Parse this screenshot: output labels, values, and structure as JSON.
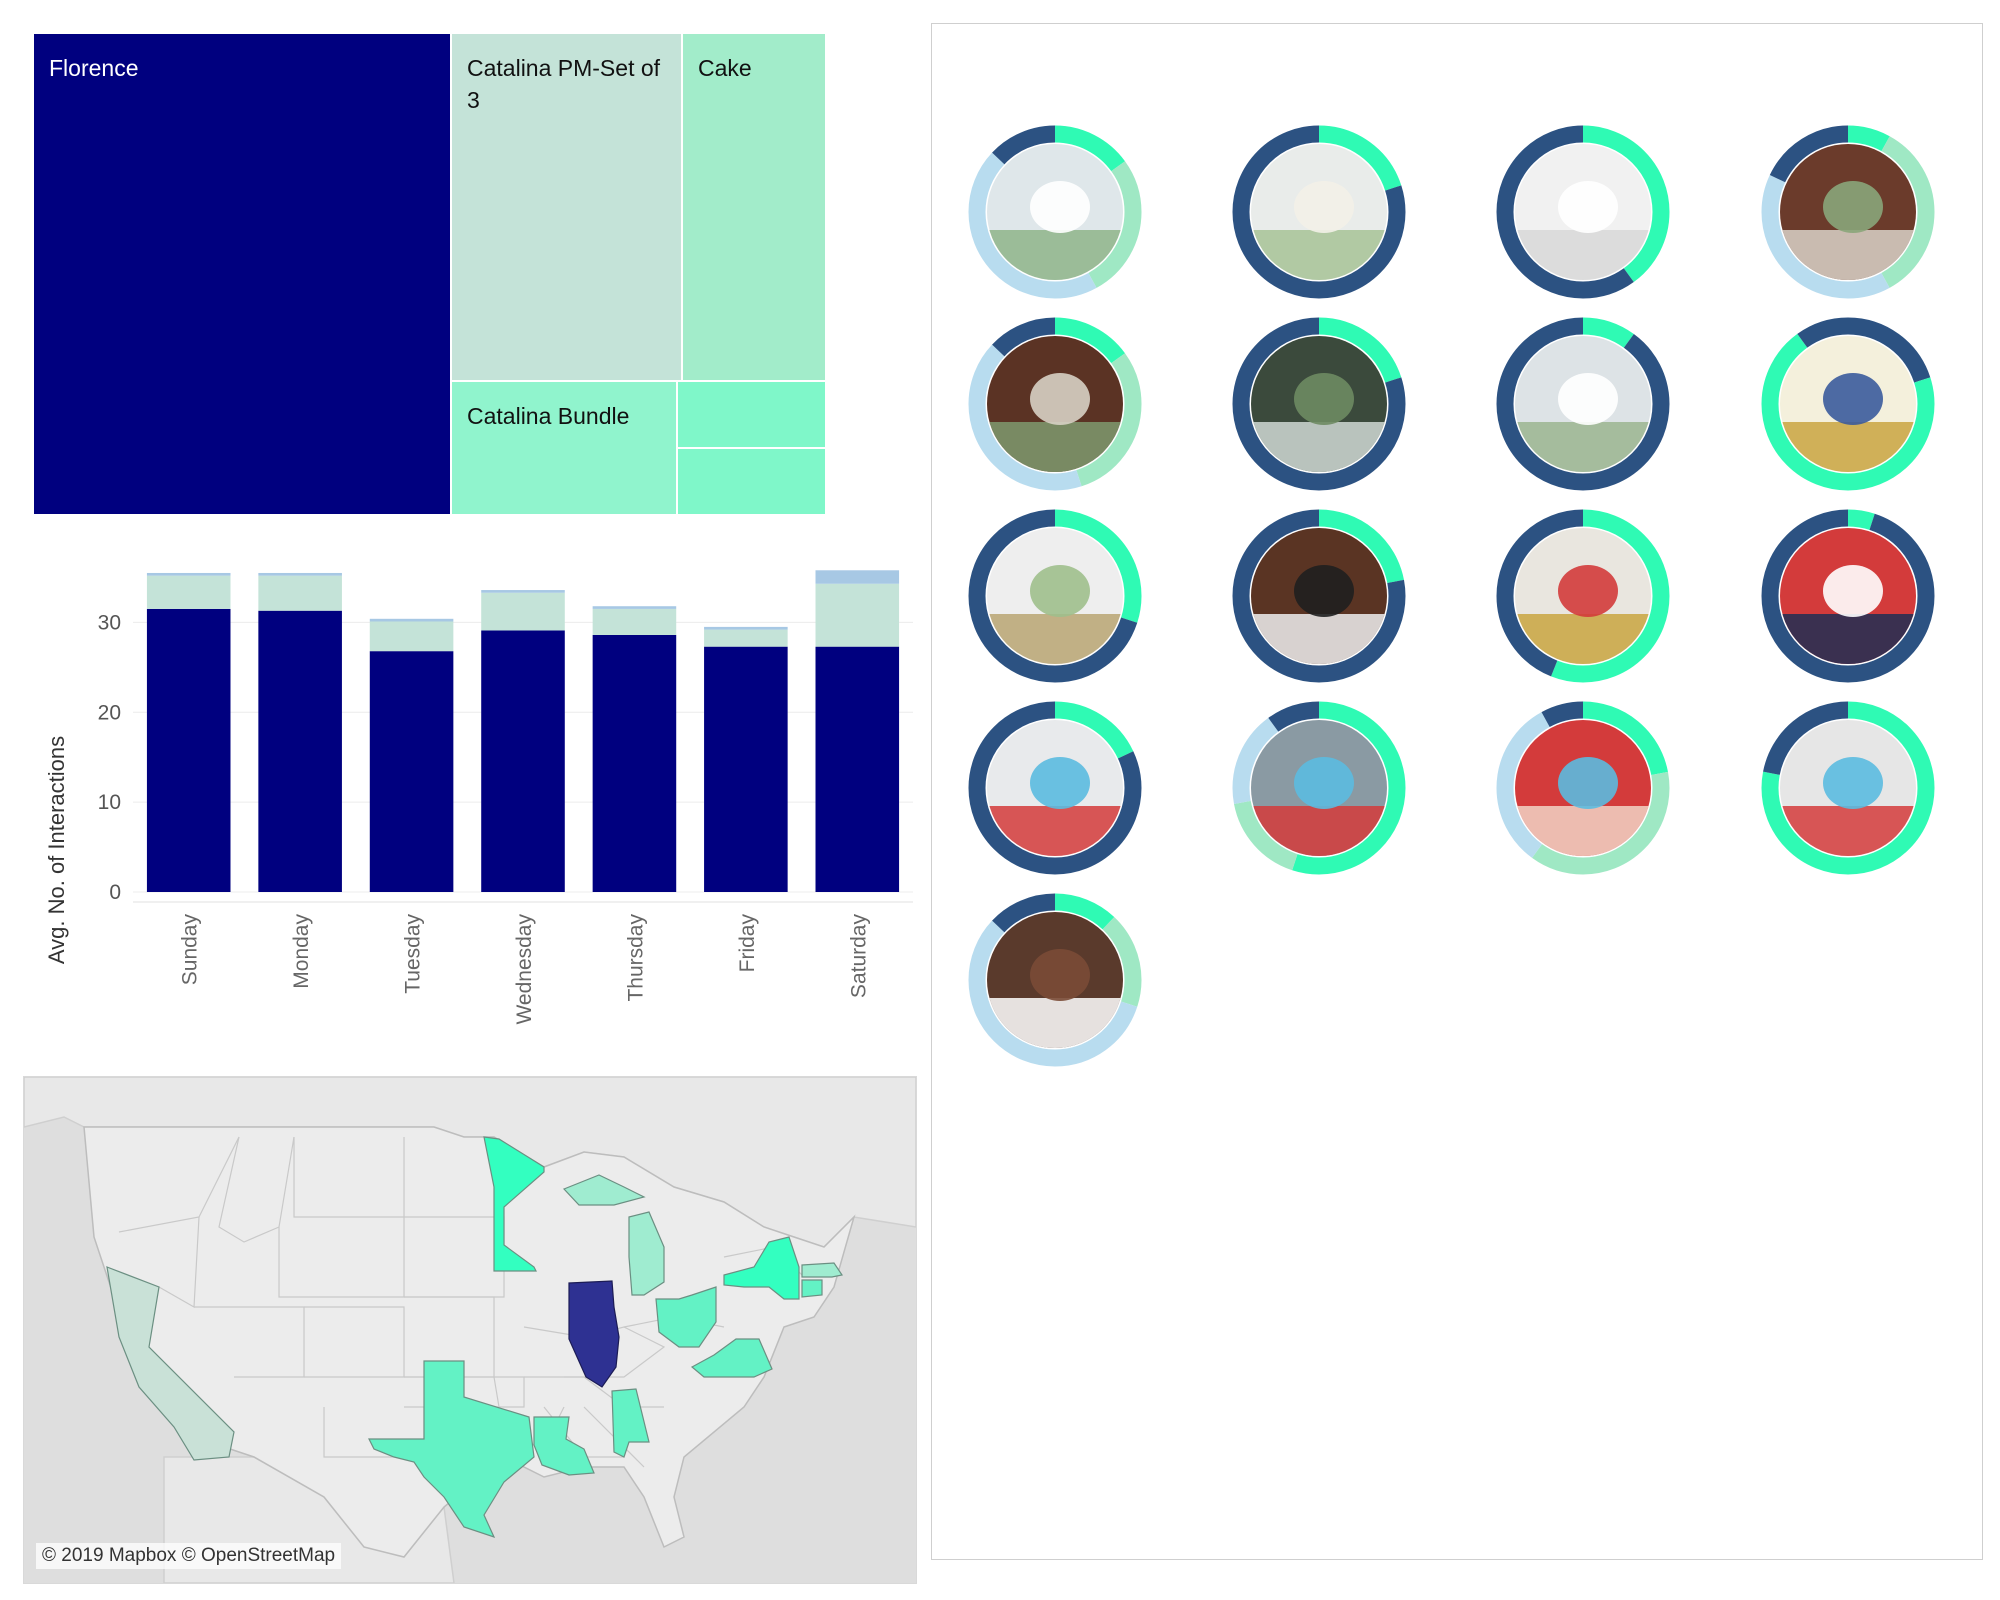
{
  "colors": {
    "navy": "#00007f",
    "pale_mint": "#c4e3d8",
    "mint": "#a2ecca",
    "mint2": "#90f4cd",
    "mint3": "#7ff7c9",
    "sky": "#a7c8e4",
    "ring_dark": "#2c5282",
    "ring_teal": "#2ffab4",
    "ring_light_green": "#9fe8c4",
    "ring_light_blue": "#b8dcef",
    "map_land": "#ececec",
    "map_water": "#dcdcdc",
    "map_border": "#c9c9c9",
    "state_illinois": "#2e3192",
    "state_bright": "#33ffc0",
    "state_medium": "#63f2c5",
    "state_light": "#9fecd0",
    "state_pale": "#c9e1d7"
  },
  "treemap": {
    "tiles": [
      {
        "label": "Florence",
        "color": "#00007f",
        "text_color": "#ffffff"
      },
      {
        "label": "Catalina PM-Set of 3",
        "color": "#c4e3d8",
        "text_color": "#111111"
      },
      {
        "label": "Cake",
        "color": "#a2ecca",
        "text_color": "#111111"
      },
      {
        "label": "Catalina Bundle",
        "color": "#90f4cd",
        "text_color": "#111111"
      },
      {
        "label": "",
        "color": "#7ff7c9",
        "text_color": "#111111"
      },
      {
        "label": "",
        "color": "#7ff7c9",
        "text_color": "#111111"
      }
    ]
  },
  "chart_data": {
    "type": "bar",
    "stacked": true,
    "categories": [
      "Sunday",
      "Monday",
      "Tuesday",
      "Wednesday",
      "Thursday",
      "Friday",
      "Saturday"
    ],
    "series": [
      {
        "values": [
          31.5,
          31.3,
          26.8,
          29.1,
          28.6,
          27.3,
          27.3
        ],
        "color": "#00007f"
      },
      {
        "values": [
          3.7,
          3.9,
          3.3,
          4.2,
          2.9,
          1.9,
          7.0
        ],
        "color": "#c4e3d8"
      },
      {
        "values": [
          0.3,
          0.3,
          0.3,
          0.3,
          0.3,
          0.3,
          1.5
        ],
        "color": "#a7c8e4"
      }
    ],
    "ylabel": "Avg. No. of Interactions",
    "xlabel": "",
    "yticks": [
      0,
      10,
      20,
      30
    ],
    "ylim": [
      0,
      37.5
    ],
    "grid": true
  },
  "map": {
    "credit": "© 2019 Mapbox © OpenStreetMap",
    "highlighted_states": [
      "Minnesota",
      "Michigan",
      "Illinois",
      "Ohio",
      "New York",
      "Massachusetts",
      "Connecticut",
      "Virginia",
      "California",
      "Texas",
      "Louisiana",
      "Alabama"
    ]
  },
  "rings": [
    {
      "image": "table-number-frame-centerpiece",
      "segments": [
        [
          "#2ffab4",
          0.15
        ],
        [
          "#9fe8c4",
          0.27
        ],
        [
          "#b8dcef",
          0.45
        ],
        [
          "#2c5282",
          0.13
        ]
      ]
    },
    {
      "image": "hydrangea-gold-vase-centerpiece",
      "segments": [
        [
          "#2ffab4",
          0.2
        ],
        [
          "#2c5282",
          0.8
        ]
      ]
    },
    {
      "image": "baby-breath-candle-centerpiece",
      "segments": [
        [
          "#2ffab4",
          0.4
        ],
        [
          "#2c5282",
          0.6
        ]
      ]
    },
    {
      "image": "wood-lantern-candle-centerpiece",
      "segments": [
        [
          "#2ffab4",
          0.08
        ],
        [
          "#9fe8c4",
          0.34
        ],
        [
          "#b8dcef",
          0.4
        ],
        [
          "#2c5282",
          0.18
        ]
      ]
    },
    {
      "image": "wood-lantern-greenery-centerpiece",
      "segments": [
        [
          "#2ffab4",
          0.15
        ],
        [
          "#9fe8c4",
          0.3
        ],
        [
          "#b8dcef",
          0.42
        ],
        [
          "#2c5282",
          0.13
        ]
      ]
    },
    {
      "image": "wreath-love-together-sign",
      "segments": [
        [
          "#2ffab4",
          0.2
        ],
        [
          "#2c5282",
          0.8
        ]
      ]
    },
    {
      "image": "greenery-hoop-floral",
      "segments": [
        [
          "#2ffab4",
          0.1
        ],
        [
          "#2c5282",
          0.9
        ]
      ]
    },
    {
      "image": "check-in-airplane-sign",
      "segments": [
        [
          "#2c5282",
          0.2
        ],
        [
          "#2ffab4",
          0.7
        ],
        [
          "#2c5282",
          0.1
        ]
      ]
    },
    {
      "image": "gold-geometric-orb-hydrangea",
      "segments": [
        [
          "#2ffab4",
          0.3
        ],
        [
          "#2c5282",
          0.7
        ]
      ]
    },
    {
      "image": "wood-lantern-candle-stripes",
      "segments": [
        [
          "#2ffab4",
          0.22
        ],
        [
          "#2c5282",
          0.78
        ]
      ]
    },
    {
      "image": "gold-geometric-orb-roses",
      "segments": [
        [
          "#2ffab4",
          0.56
        ],
        [
          "#2c5282",
          0.44
        ]
      ]
    },
    {
      "image": "birthday-package-nautical",
      "segments": [
        [
          "#2ffab4",
          0.05
        ],
        [
          "#2c5282",
          0.95
        ]
      ]
    },
    {
      "image": "nautical-party-hat",
      "segments": [
        [
          "#2ffab4",
          0.18
        ],
        [
          "#2c5282",
          0.82
        ]
      ]
    },
    {
      "image": "happy-birthday-banner",
      "segments": [
        [
          "#2ffab4",
          0.55
        ],
        [
          "#9fe8c4",
          0.17
        ],
        [
          "#b8dcef",
          0.18
        ],
        [
          "#2c5282",
          0.1
        ]
      ]
    },
    {
      "image": "one-cake-topper-banner",
      "segments": [
        [
          "#2ffab4",
          0.22
        ],
        [
          "#9fe8c4",
          0.38
        ],
        [
          "#b8dcef",
          0.32
        ],
        [
          "#2c5282",
          0.08
        ]
      ]
    },
    {
      "image": "red-white-ribbon-garland",
      "segments": [
        [
          "#2ffab4",
          0.78
        ],
        [
          "#2c5282",
          0.22
        ]
      ]
    },
    {
      "image": "better-together-wood-sign",
      "segments": [
        [
          "#2ffab4",
          0.12
        ],
        [
          "#9fe8c4",
          0.18
        ],
        [
          "#b8dcef",
          0.57
        ],
        [
          "#2c5282",
          0.13
        ]
      ]
    }
  ]
}
